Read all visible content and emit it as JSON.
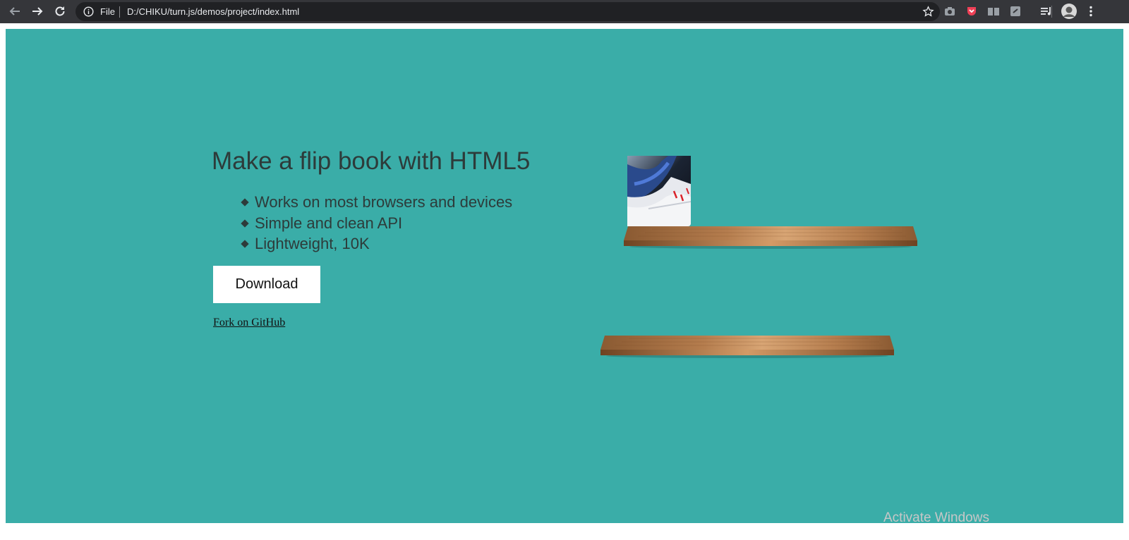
{
  "browser": {
    "file_label": "File",
    "url": "D:/CHIKU/turn.js/demos/project/index.html",
    "icons": [
      "back-arrow-icon",
      "forward-arrow-icon",
      "reload-icon",
      "info-icon",
      "star-icon",
      "camera-icon",
      "pocket-icon",
      "reader-icon",
      "shield-extension-icon",
      "media-queue-icon",
      "profile-avatar-icon",
      "more-menu-icon"
    ]
  },
  "content": {
    "headline": "Make a flip book with HTML5",
    "features": [
      "Works on most browsers and devices",
      "Simple and clean API",
      "Lightweight, 10K"
    ],
    "download_label": "Download",
    "fork_label": "Fork on GitHub"
  },
  "colors": {
    "page_background": "#3aada8",
    "text": "#2d3b3a",
    "toolbar": "#35363a",
    "omnibox": "#202124",
    "shelf_wood": "#b07a4c"
  },
  "os": {
    "watermark": "Activate Windows"
  }
}
